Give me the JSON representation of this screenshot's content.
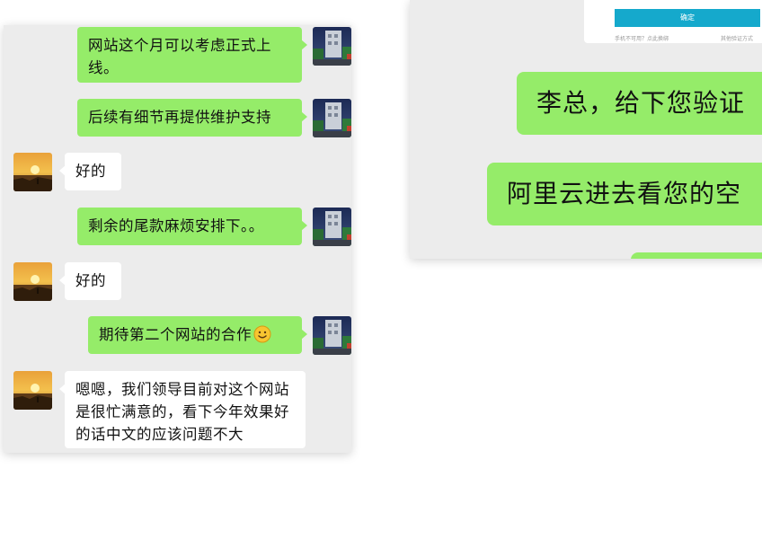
{
  "left_chat": {
    "messages": [
      {
        "from": "self",
        "text": "网站这个月可以考虑正式上线。"
      },
      {
        "from": "self",
        "text": "后续有细节再提供维护支持"
      },
      {
        "from": "peer",
        "text": "好的"
      },
      {
        "from": "self",
        "text": "剩余的尾款麻烦安排下。。"
      },
      {
        "from": "peer",
        "text": "好的"
      },
      {
        "from": "self",
        "text": "期待第二个网站的合作",
        "emoji": "smiling-face-icon"
      },
      {
        "from": "peer",
        "text": "嗯嗯，我们领导目前对这个网站是很忙满意的，看下今年效果好的话中文的应该问题不大"
      }
    ]
  },
  "right_chat": {
    "mini_screenshot": {
      "confirm_label": "确定",
      "note_left": "手机不可用？点此换绑",
      "note_right": "其他验证方式"
    },
    "messages": [
      {
        "from": "self",
        "text": "李总，给下您验证"
      },
      {
        "from": "self",
        "text": "阿里云进去看您的空"
      }
    ]
  },
  "colors": {
    "self_bubble": "#95ec69",
    "peer_bubble": "#ffffff",
    "chat_background": "#ececec",
    "confirm_button": "#15a9cc"
  }
}
